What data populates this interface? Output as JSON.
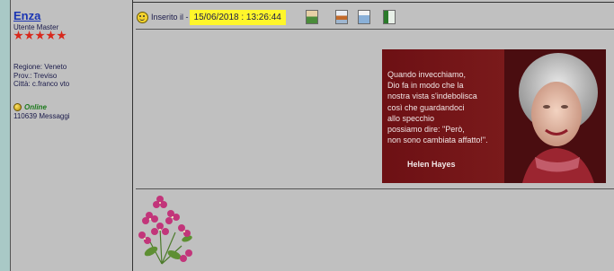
{
  "author": {
    "name": "Enza",
    "rank": "Utente Master",
    "stars": 5,
    "region": "Regione: Veneto",
    "province": "Prov.: Treviso",
    "city": "Città: c.franco vto",
    "status": "Online",
    "messages": "110639 Messaggi"
  },
  "post": {
    "inserted_label": "Inserito il -",
    "timestamp": "15/06/2018 : 13:26:44",
    "toolbar_icons": [
      "profile-icon",
      "homepage-icon",
      "email-icon",
      "document-icon"
    ],
    "quote_image": {
      "quote": "Quando invecchiamo,\nDio fa in modo che la\nnostra vista s'indebolisca\ncosì che guardandoci\nallo specchio\npossiamo dire: \"Però,\nnon sono cambiata affatto!\".",
      "author": "Helen Hayes"
    }
  },
  "colors": {
    "link": "#1a34b3",
    "highlight": "#fff62a",
    "background": "#c0c0c0",
    "online": "#1c7a1c",
    "left_edge": "#a9c9c6",
    "quote_bg": "#7a1a1b"
  }
}
